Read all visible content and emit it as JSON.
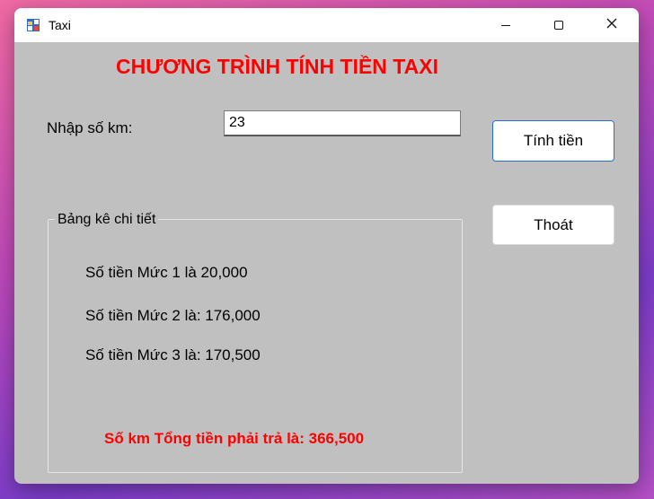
{
  "window": {
    "title": "Taxi",
    "icon": "app-window-icon",
    "controls": [
      "minimize-icon",
      "maximize-icon",
      "close-icon"
    ]
  },
  "form": {
    "heading": "CHƯƠNG TRÌNH TÍNH TIỀN TAXI",
    "km_label": "Nhập số km:",
    "km_value": "23",
    "calc_button": "Tính tiền",
    "exit_button": "Thoát"
  },
  "details": {
    "group_title": "Bảng kê chi tiết",
    "lines": [
      "Số tiền Mức 1 là 20,000",
      "Số tiền Mức 2 là: 176,000",
      "Số tiền Mức 3 là: 170,500"
    ],
    "total": "Số km Tổng tiền phải trả là: 366,500"
  },
  "colors": {
    "accent_red": "#ff0000",
    "form_background": "#c0c0c0",
    "focus_border": "#2a6fd6"
  }
}
